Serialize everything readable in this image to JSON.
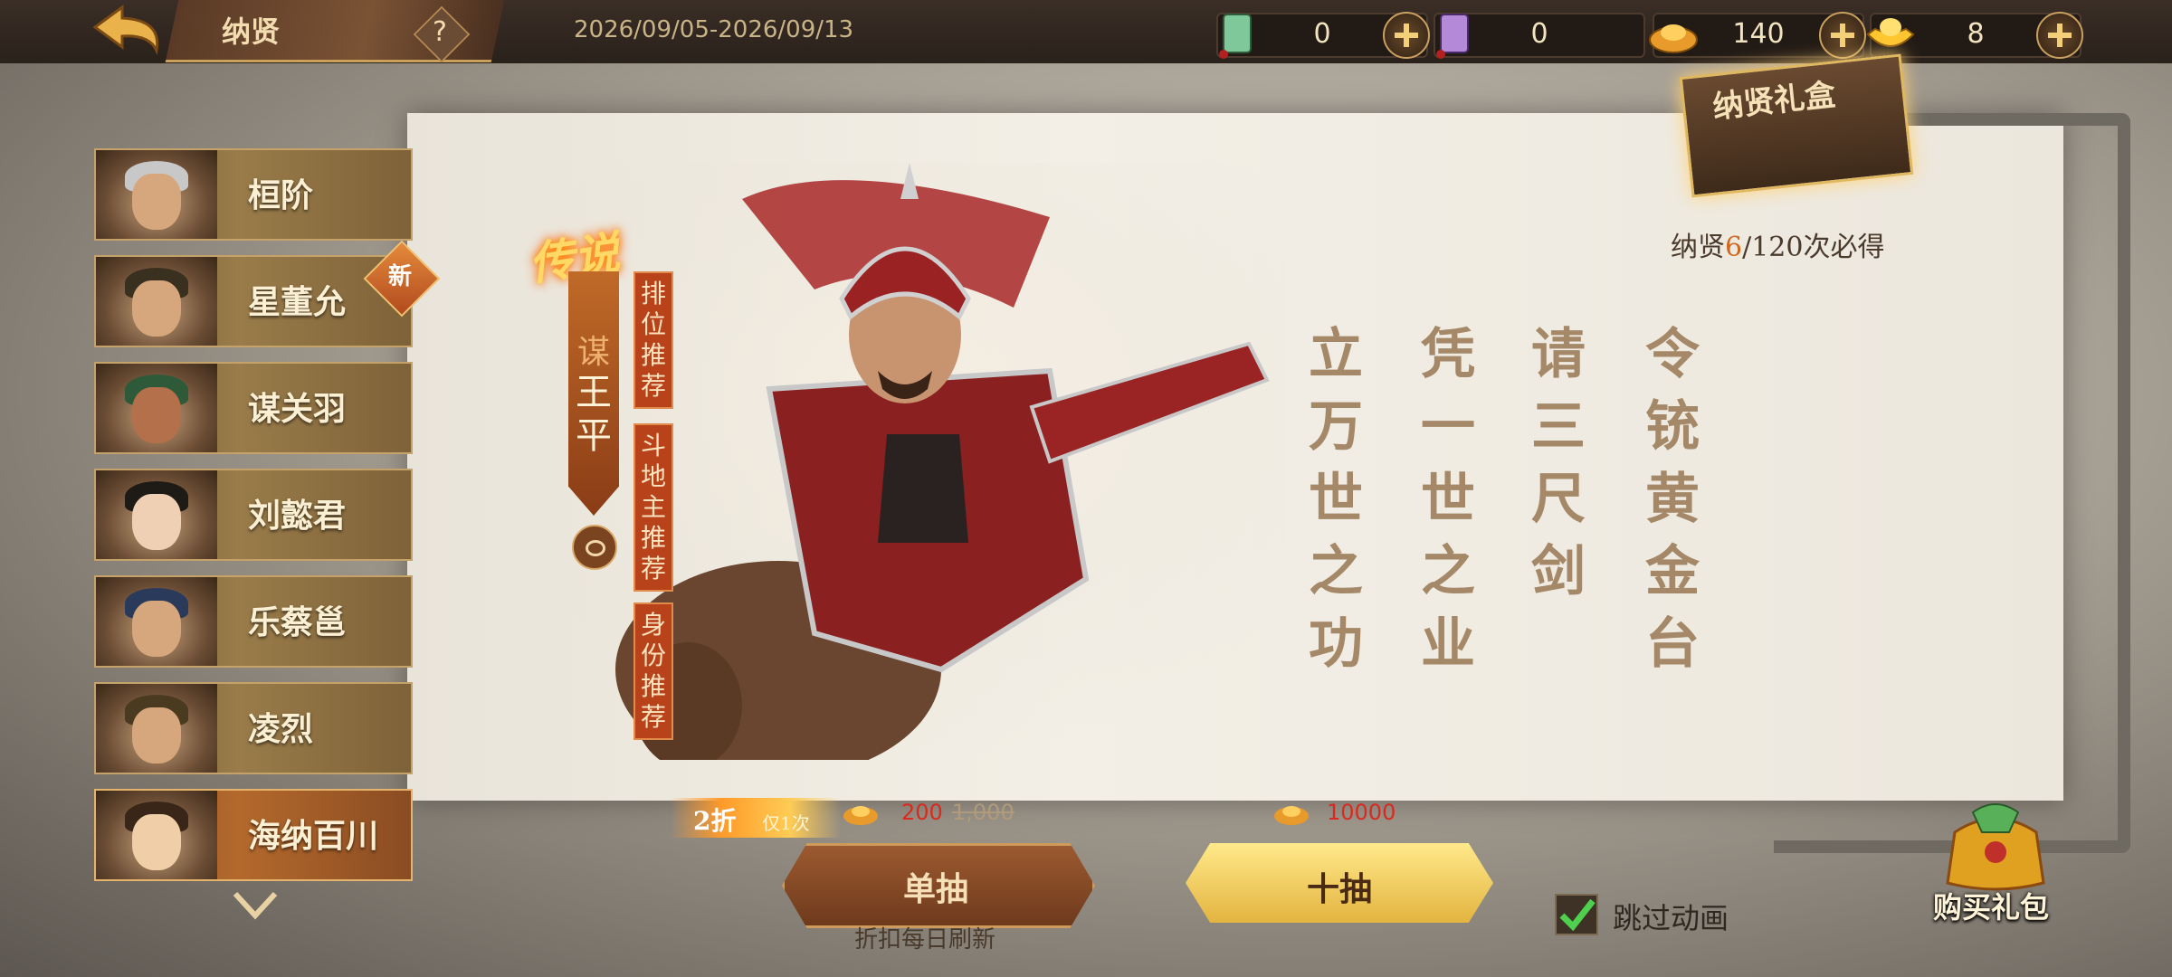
{
  "header": {
    "title": "纳贤",
    "help_label": "?",
    "date_range": "2026/09/05-2026/09/13"
  },
  "resources": [
    {
      "icon": "green-scroll-icon",
      "value": "0"
    },
    {
      "icon": "purple-scroll-icon",
      "value": "0"
    },
    {
      "icon": "gold-ingot-icon",
      "value": "140"
    },
    {
      "icon": "yuanbao-icon",
      "value": "8"
    }
  ],
  "hero_list": [
    {
      "name": "桓阶"
    },
    {
      "name": "星董允",
      "badge": "新"
    },
    {
      "name": "谋关羽"
    },
    {
      "name": "刘懿君"
    },
    {
      "name": "乐蔡邕"
    },
    {
      "name": "凌烈"
    },
    {
      "name": "海纳百川",
      "active": true
    }
  ],
  "featured": {
    "rarity": "传说",
    "prefix": "谋",
    "name": "王平",
    "tags": [
      "排位推荐",
      "斗地主推荐",
      "身份推荐"
    ]
  },
  "calligraphy": [
    "立万世之功",
    "凭一世之业",
    "请三尺剑",
    "令铳黄金台"
  ],
  "gift_box": {
    "label": "纳贤礼盒"
  },
  "pity": {
    "prefix": "纳贤",
    "current": "6",
    "suffix": "/120次必得"
  },
  "single_draw": {
    "discount": "2折",
    "discount_note": "仅1次",
    "cost_now": "200",
    "cost_original": "1,000",
    "label": "单抽",
    "note": "折扣每日刷新"
  },
  "ten_draw": {
    "cost": "10000",
    "label": "十抽"
  },
  "skip_animation": {
    "label": "跳过动画",
    "checked": true
  },
  "buy_pack": {
    "label": "购买礼包"
  },
  "colors": {
    "accent": "#d2661e",
    "gold": "#e3b440",
    "primary_button": "#9c5a30"
  }
}
